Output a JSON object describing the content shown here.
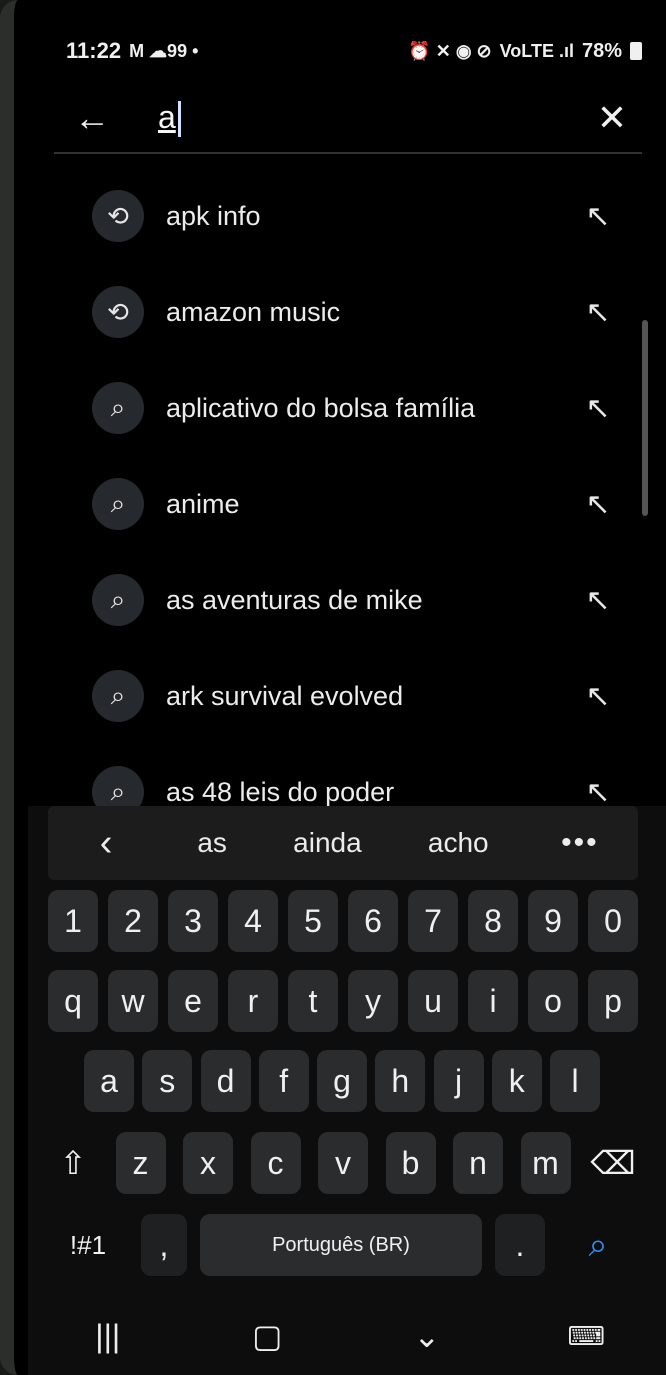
{
  "status_bar": {
    "time": "11:22",
    "notifications": "M ☁99 •",
    "right_icons": "⏰ ✕ ◉ ⊘ ",
    "signal_text": "VoLTE .ıl",
    "battery": "78%"
  },
  "search": {
    "query": "a",
    "back_icon": "arrow-left-icon",
    "clear_icon": "close-icon"
  },
  "suggestions": [
    {
      "text": "apk info",
      "icon": "history-icon",
      "glyph": "⟲"
    },
    {
      "text": "amazon music",
      "icon": "history-icon",
      "glyph": "⟲"
    },
    {
      "text": "aplicativo do bolsa família",
      "icon": "search-icon",
      "glyph": "⌕"
    },
    {
      "text": "anime",
      "icon": "search-icon",
      "glyph": "⌕"
    },
    {
      "text": "as aventuras de mike",
      "icon": "search-icon",
      "glyph": "⌕"
    },
    {
      "text": "ark survival evolved",
      "icon": "search-icon",
      "glyph": "⌕"
    },
    {
      "text": "as 48 leis do poder",
      "icon": "search-icon",
      "glyph": "⌕"
    }
  ],
  "keyboard": {
    "suggestions": [
      "as",
      "ainda",
      "acho"
    ],
    "more": "•••",
    "row1": [
      "1",
      "2",
      "3",
      "4",
      "5",
      "6",
      "7",
      "8",
      "9",
      "0"
    ],
    "row2": [
      "q",
      "w",
      "e",
      "r",
      "t",
      "y",
      "u",
      "i",
      "o",
      "p"
    ],
    "row3": [
      "a",
      "s",
      "d",
      "f",
      "g",
      "h",
      "j",
      "k",
      "l"
    ],
    "row4": [
      "z",
      "x",
      "c",
      "v",
      "b",
      "n",
      "m"
    ],
    "symbols_label": "!#1",
    "comma": ",",
    "space_label": "Português (BR)",
    "period": "."
  }
}
